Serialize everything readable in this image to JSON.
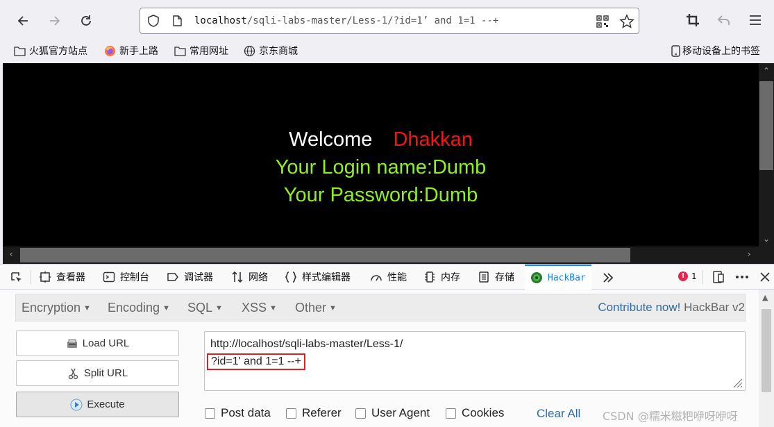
{
  "browser": {
    "url": {
      "host": "localhost",
      "path": "/sqli-labs-master/Less-1/?id=1’ and 1=1 --+"
    }
  },
  "bookmarks": [
    {
      "label": "火狐官方站点"
    },
    {
      "label": "新手上路"
    },
    {
      "label": "常用网址"
    },
    {
      "label": "京东商城"
    }
  ],
  "bookmarks_right": "移动设备上的书签",
  "page": {
    "welcome": "Welcome",
    "name": "Dhakkan",
    "login_line": "Your Login name:Dumb",
    "password_line": "Your Password:Dumb"
  },
  "devtools": {
    "tabs": [
      {
        "label": "查看器",
        "icon": "inspector-icon"
      },
      {
        "label": "控制台",
        "icon": "console-icon"
      },
      {
        "label": "调试器",
        "icon": "debugger-icon"
      },
      {
        "label": "网络",
        "icon": "network-icon"
      },
      {
        "label": "样式编辑器",
        "icon": "style-editor-icon"
      },
      {
        "label": "性能",
        "icon": "performance-icon"
      },
      {
        "label": "内存",
        "icon": "memory-icon"
      },
      {
        "label": "存储",
        "icon": "storage-icon"
      },
      {
        "label": "HackBar",
        "icon": "hackbar-icon",
        "active": true
      }
    ],
    "error_count": "1"
  },
  "hackbar": {
    "menu": [
      "Encryption",
      "Encoding",
      "SQL",
      "XSS",
      "Other"
    ],
    "contribute_link": "Contribute now!",
    "version": "HackBar v2",
    "buttons": {
      "load": "Load URL",
      "split": "Split URL",
      "execute": "Execute"
    },
    "url_line1": "http://localhost/sqli-labs-master/Less-1/",
    "url_line2": "?id=1' and 1=1 --+",
    "options": [
      "Post data",
      "Referer",
      "User Agent",
      "Cookies"
    ],
    "clear_all": "Clear All"
  },
  "watermark": "CSDN @糯米糍粑咿呀咿呀",
  "colors": {
    "accent": "#0a84ff",
    "welcome_name": "#f21616",
    "login_text": "#8ef021",
    "highlight_box": "#e02020"
  }
}
